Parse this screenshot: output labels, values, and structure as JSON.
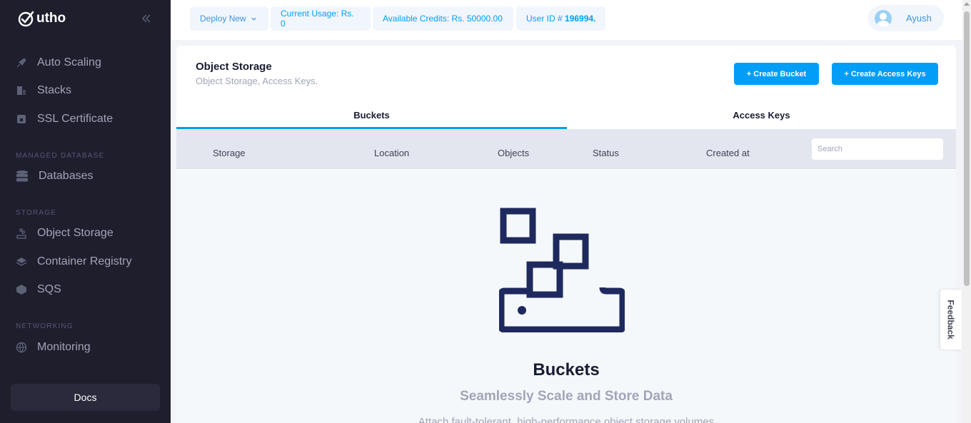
{
  "brand": {
    "name": "utho"
  },
  "sidebar": {
    "items": [
      {
        "label": "Auto Scaling",
        "icon": "rocket-icon"
      },
      {
        "label": "Stacks",
        "icon": "stack-icon"
      },
      {
        "label": "SSL Certificate",
        "icon": "lock-icon"
      }
    ],
    "sections": [
      {
        "label": "MANAGED DATABASE",
        "items": [
          {
            "label": "Databases",
            "icon": "database-icon"
          }
        ]
      },
      {
        "label": "STORAGE",
        "items": [
          {
            "label": "Object Storage",
            "icon": "object-storage-icon"
          },
          {
            "label": "Container Registry",
            "icon": "container-icon"
          },
          {
            "label": "SQS",
            "icon": "queue-icon"
          }
        ]
      },
      {
        "label": "NETWORKING",
        "items": [
          {
            "label": "Monitoring",
            "icon": "globe-icon"
          }
        ]
      }
    ],
    "docs_label": "Docs"
  },
  "header": {
    "deploy_label": "Deploy New",
    "usage_label": "Current Usage: Rs. 0",
    "credits_label": "Available Credits: Rs. 50000.00",
    "user_id_prefix": "User ID # ",
    "user_id": "196994.",
    "user_name": "Ayush"
  },
  "page": {
    "title": "Object Storage",
    "subtitle": "Object Storage, Access Keys.",
    "create_bucket_label": "+ Create Bucket",
    "create_keys_label": "+ Create Access Keys"
  },
  "tabs": [
    {
      "label": "Buckets",
      "active": true
    },
    {
      "label": "Access Keys",
      "active": false
    }
  ],
  "table": {
    "columns": [
      "Storage",
      "Location",
      "Objects",
      "Status",
      "Created at"
    ],
    "search_placeholder": "Search"
  },
  "empty_state": {
    "title": "Buckets",
    "subtitle": "Seamlessly Scale and Store Data",
    "description": "Attach fault-tolerant, high-performance object storage volumes"
  },
  "feedback_label": "Feedback",
  "colors": {
    "accent": "#009ef7",
    "sidebar_bg": "#1e1e2d",
    "illustration": "#1e2a5e"
  }
}
